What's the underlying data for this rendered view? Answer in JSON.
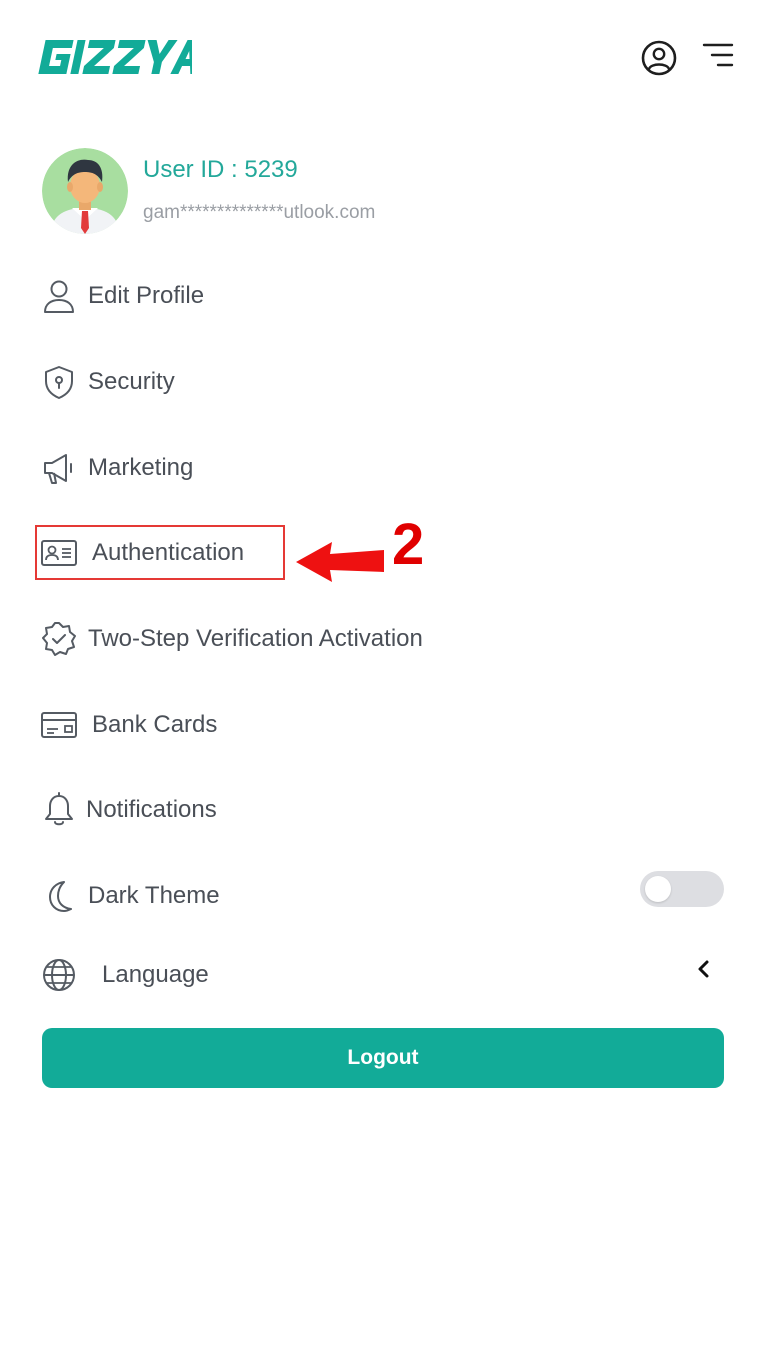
{
  "brand": {
    "logo_text": "GIZZYA",
    "accent_color": "#12ab98"
  },
  "header": {
    "profile_icon": "user-circle-icon",
    "menu_icon": "hamburger-menu-icon"
  },
  "profile": {
    "user_id": "User ID : 5239",
    "email": "gam**************utlook.com",
    "avatar_icon": "avatar"
  },
  "menu": {
    "items": [
      {
        "label": "Edit Profile",
        "icon": "user-icon"
      },
      {
        "label": "Security",
        "icon": "shield-icon"
      },
      {
        "label": "Marketing",
        "icon": "megaphone-icon"
      },
      {
        "label": "Authentication",
        "icon": "id-card-icon"
      },
      {
        "label": "Two-Step Verification Activation",
        "icon": "verified-badge-icon"
      },
      {
        "label": "Bank Cards",
        "icon": "credit-card-icon"
      },
      {
        "label": "Notifications",
        "icon": "bell-icon"
      },
      {
        "label": "Dark Theme",
        "icon": "moon-icon"
      },
      {
        "label": "Language",
        "icon": "globe-icon"
      }
    ]
  },
  "dark_theme": {
    "enabled": false
  },
  "language": {
    "chevron_icon": "chevron-left-icon"
  },
  "logout": {
    "label": "Logout"
  },
  "annotation": {
    "step_number": "2",
    "color": "#e53935"
  }
}
